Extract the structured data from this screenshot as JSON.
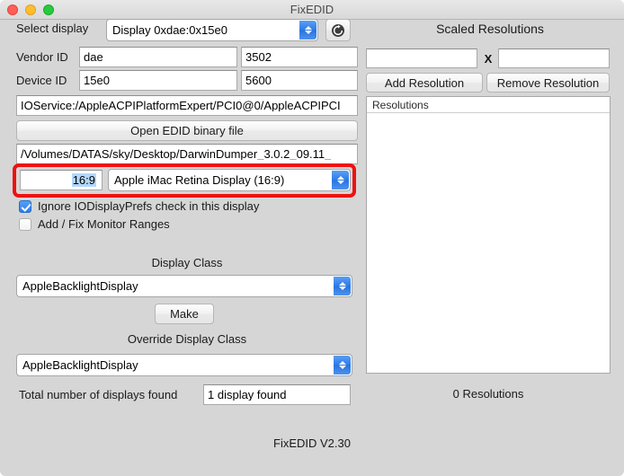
{
  "window": {
    "title": "FixEDID",
    "controls": {
      "close": "close-button",
      "minimize": "minimize-button",
      "maximize": "maximize-button"
    }
  },
  "left": {
    "select_display_label": "Select display",
    "select_display_value": "Display 0xdae:0x15e0",
    "refresh_icon": "refresh-icon",
    "vendor_id_label": "Vendor ID",
    "vendor_id_value": "dae",
    "vendor_id_alt_value": "3502",
    "device_id_label": "Device ID",
    "device_id_value": "15e0",
    "device_id_alt_value": "5600",
    "ioservice_path": "IOService:/AppleACPIPlatformExpert/PCI0@0/AppleACPIPCI",
    "open_edid_button": "Open EDID binary file",
    "edid_file_path": "/Volumes/DATAS/sky/Desktop/DarwinDumper_3.0.2_09.11_",
    "aspect_ratio_value": "16:9",
    "display_model_value": "Apple iMac Retina Display (16:9)",
    "checkbox_ignore_label": "Ignore IODisplayPrefs check in this display",
    "checkbox_ignore_checked": true,
    "checkbox_ranges_label": "Add / Fix Monitor Ranges",
    "checkbox_ranges_checked": false,
    "display_class_label": "Display Class",
    "display_class_value": "AppleBacklightDisplay",
    "make_button": "Make",
    "override_display_class_label": "Override Display Class",
    "override_display_class_value": "AppleBacklightDisplay",
    "total_displays_label": "Total number of displays found",
    "total_displays_value": "1 display found"
  },
  "right": {
    "panel_title": "Scaled Resolutions",
    "width_value": "",
    "height_value": "",
    "x_separator": "X",
    "add_resolution_button": "Add Resolution",
    "remove_resolution_button": "Remove Resolution",
    "list_header": "Resolutions",
    "list_items": [],
    "resolution_count": "0 Resolutions"
  },
  "footer": {
    "version": "FixEDID V2.30"
  },
  "colors": {
    "window_bg": "#d6d6d6",
    "accent_blue": "#2d7bea",
    "annotation_red": "#ee1111",
    "selection_blue": "#b3d7fd"
  }
}
